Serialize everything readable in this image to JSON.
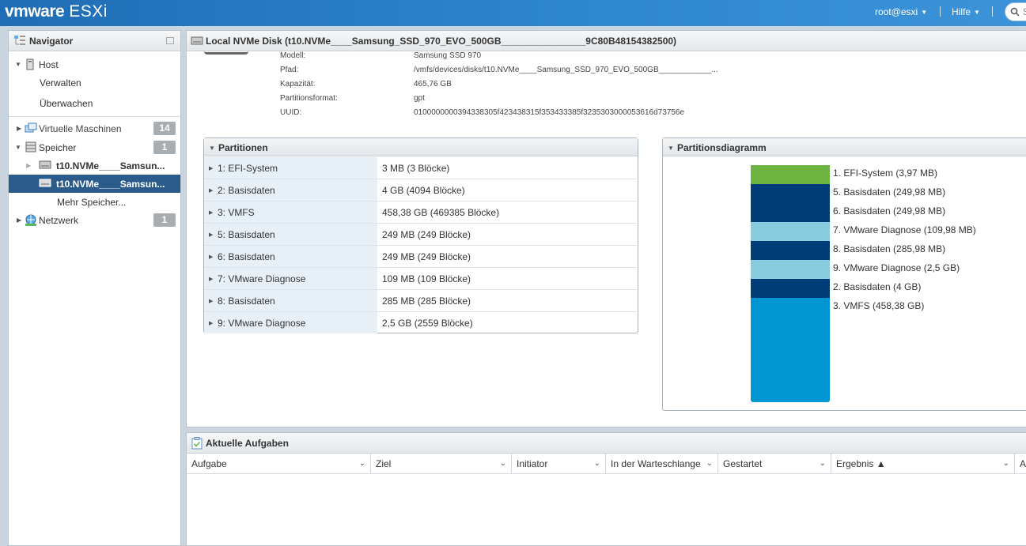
{
  "topbar": {
    "logo_vm": "vmware",
    "logo_product": "ESXi",
    "user_menu": "root@esxi",
    "help_menu": "Hilfe",
    "search_placeholder": "S"
  },
  "navigator": {
    "title": "Navigator",
    "host": {
      "label": "Host",
      "children": [
        "Verwalten",
        "Überwachen"
      ]
    },
    "vms": {
      "label": "Virtuelle Maschinen",
      "count": "14"
    },
    "storage": {
      "label": "Speicher",
      "count": "1",
      "items": [
        "t10.NVMe____Samsun...",
        "t10.NVMe____Samsun..."
      ],
      "more": "Mehr Speicher..."
    },
    "network": {
      "label": "Netzwerk",
      "count": "1"
    }
  },
  "main": {
    "title": "Local NVMe Disk (t10.NVMe____Samsung_SSD_970_EVO_500GB________________9C80B48154382500)",
    "info": [
      {
        "key": "Modell:",
        "value": "Samsung SSD 970"
      },
      {
        "key": "Pfad:",
        "value": "/vmfs/devices/disks/t10.NVMe____Samsung_SSD_970_EVO_500GB____________..."
      },
      {
        "key": "Kapazität:",
        "value": "465,76 GB"
      },
      {
        "key": "Partitionsformat:",
        "value": "gpt"
      },
      {
        "key": "UUID:",
        "value": "0100000000394338305f423438315f353433385f3235303000053616d73756e"
      }
    ],
    "partitions": {
      "title": "Partitionen",
      "rows": [
        {
          "name": "1: EFI-System",
          "size": "3 MB (3 Blöcke)"
        },
        {
          "name": "2: Basisdaten",
          "size": "4 GB (4094 Blöcke)"
        },
        {
          "name": "3: VMFS",
          "size": "458,38 GB (469385 Blöcke)"
        },
        {
          "name": "5: Basisdaten",
          "size": "249 MB (249 Blöcke)"
        },
        {
          "name": "6: Basisdaten",
          "size": "249 MB (249 Blöcke)"
        },
        {
          "name": "7: VMware Diagnose",
          "size": "109 MB (109 Blöcke)"
        },
        {
          "name": "8: Basisdaten",
          "size": "285 MB (285 Blöcke)"
        },
        {
          "name": "9: VMware Diagnose",
          "size": "2,5 GB (2559 Blöcke)"
        }
      ]
    },
    "diagram": {
      "title": "Partitionsdiagramm",
      "segments": [
        {
          "label": "1. EFI-System   (3,97 MB)",
          "color": "#6db33f"
        },
        {
          "label": "5. Basisdaten   (249,98 MB)",
          "color": "#003d79"
        },
        {
          "label": "6. Basisdaten   (249,98 MB)",
          "color": "#003d79"
        },
        {
          "label": "7. VMware Diagnose   (109,98 MB)",
          "color": "#89cbdf"
        },
        {
          "label": "8. Basisdaten   (285,98 MB)",
          "color": "#003d79"
        },
        {
          "label": "9. VMware Diagnose   (2,5 GB)",
          "color": "#89cbdf"
        },
        {
          "label": "2. Basisdaten   (4 GB)",
          "color": "#003d79"
        },
        {
          "label": "3. VMFS   (458,38 GB)",
          "color": "#0095d3"
        }
      ]
    }
  },
  "tasks": {
    "title": "Aktuelle Aufgaben",
    "columns": [
      "Aufgabe",
      "Ziel",
      "Initiator",
      "In der Warteschlange",
      "Gestartet",
      "Ergebnis ▲",
      "Al"
    ]
  }
}
